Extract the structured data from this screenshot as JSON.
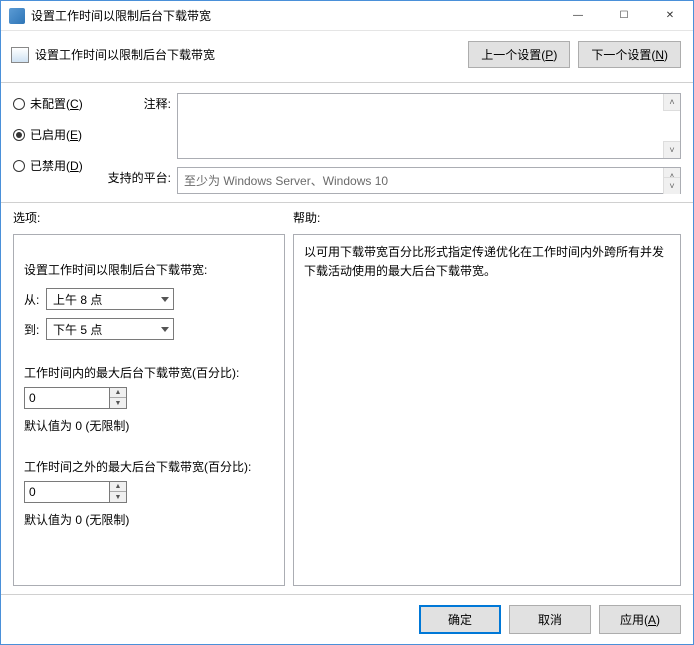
{
  "window": {
    "title": "设置工作时间以限制后台下载带宽",
    "minimize": "—",
    "maximize": "☐",
    "close": "✕"
  },
  "subheader": {
    "title": "设置工作时间以限制后台下载带宽",
    "prev": "上一个设置",
    "prev_key": "P",
    "next": "下一个设置",
    "next_key": "N"
  },
  "radios": {
    "not_configured": "未配置",
    "not_configured_key": "C",
    "enabled": "已启用",
    "enabled_key": "E",
    "disabled": "已禁用",
    "disabled_key": "D"
  },
  "info": {
    "comment_label": "注释:",
    "platform_label": "支持的平台:",
    "platform_value": "至少为 Windows Server、Windows 10"
  },
  "labels": {
    "options": "选项:",
    "help": "帮助:"
  },
  "options": {
    "title": "设置工作时间以限制后台下载带宽:",
    "from_label": "从:",
    "from_value": "上午 8 点",
    "to_label": "到:",
    "to_value": "下午 5 点",
    "in_hours_label": "工作时间内的最大后台下载带宽(百分比):",
    "in_hours_value": "0",
    "in_hours_hint": "默认值为 0 (无限制)",
    "out_hours_label": "工作时间之外的最大后台下载带宽(百分比):",
    "out_hours_value": "0",
    "out_hours_hint": "默认值为 0 (无限制)"
  },
  "help": {
    "text": "以可用下载带宽百分比形式指定传递优化在工作时间内外跨所有并发下载活动使用的最大后台下载带宽。"
  },
  "footer": {
    "ok": "确定",
    "cancel": "取消",
    "apply": "应用",
    "apply_key": "A"
  }
}
